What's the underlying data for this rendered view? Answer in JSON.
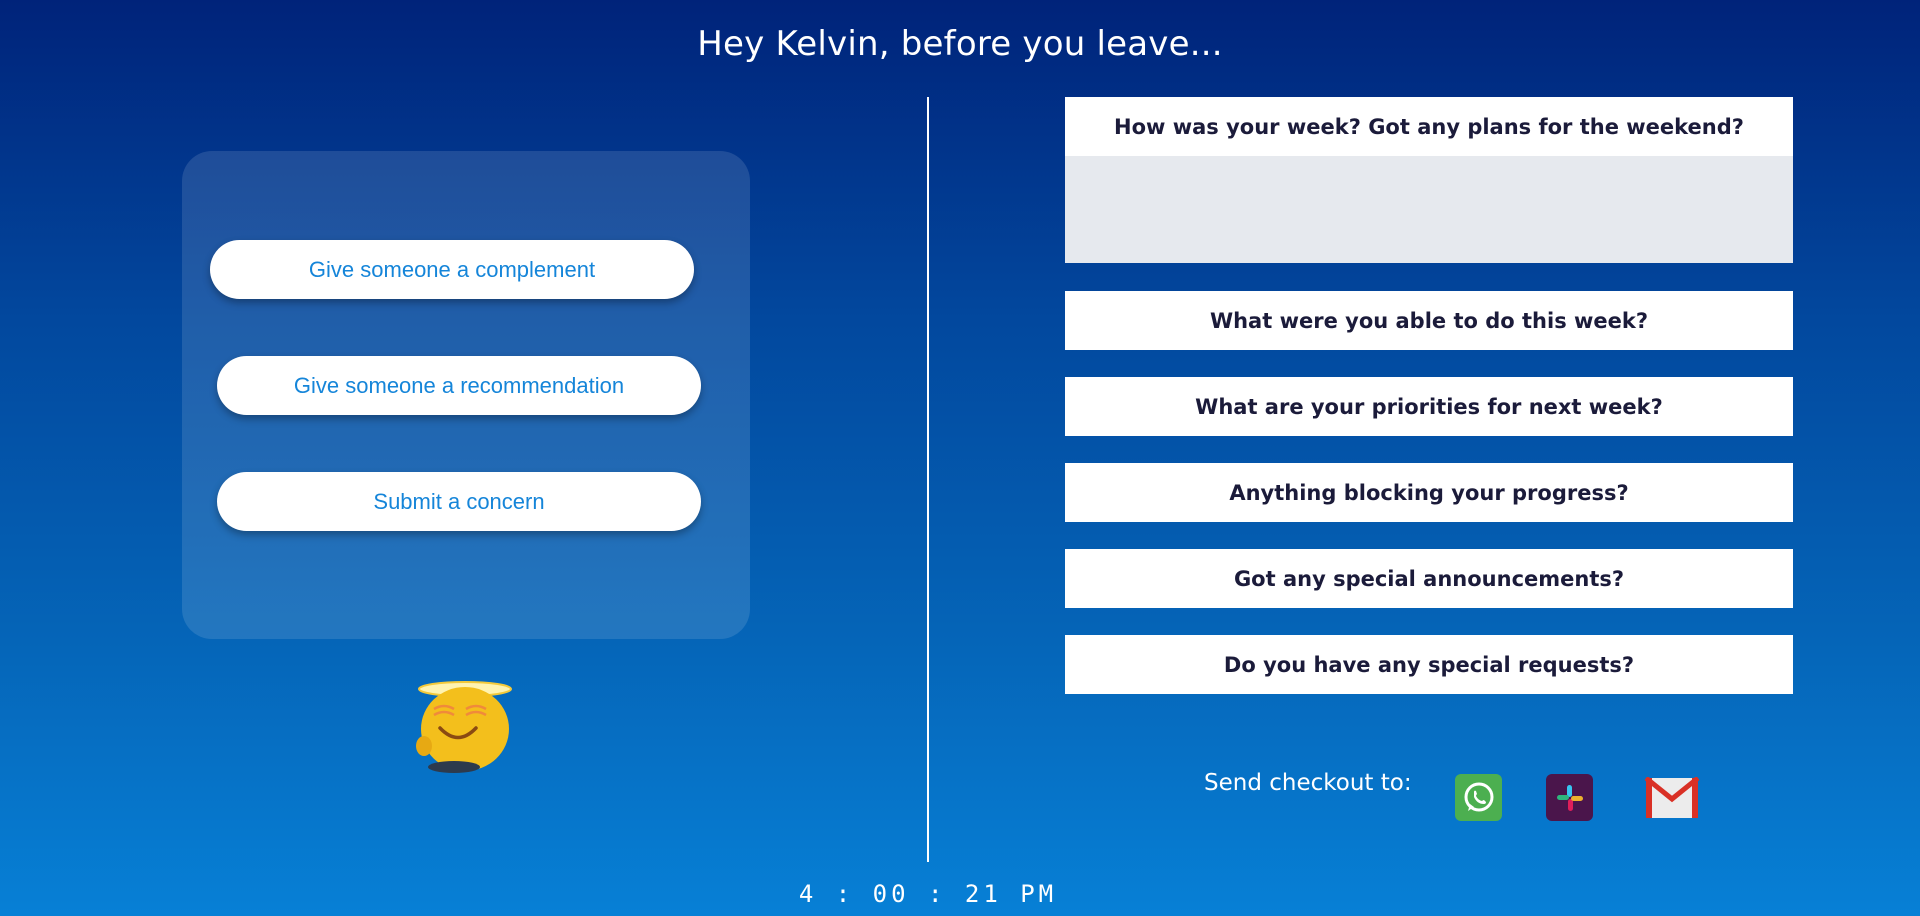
{
  "header": {
    "title": "Hey Kelvin, before you leave..."
  },
  "actions": {
    "complement_label": "Give someone a complement",
    "recommendation_label": "Give someone a recommendation",
    "concern_label": "Submit a concern"
  },
  "questions": [
    {
      "label": "How was your week? Got any plans for the weekend?",
      "value": ""
    },
    {
      "label": "What were you able to do this week?"
    },
    {
      "label": "What are your priorities for next week?"
    },
    {
      "label": "Anything blocking your progress?"
    },
    {
      "label": "Got any special announcements?"
    },
    {
      "label": "Do you have any special requests?"
    }
  ],
  "send": {
    "label": "Send checkout to:",
    "targets": [
      {
        "icon": "whatsapp-icon",
        "color": "#4caf50"
      },
      {
        "icon": "slack-icon",
        "color": "#4a154b"
      },
      {
        "icon": "gmail-icon",
        "color": "#e53935"
      }
    ]
  },
  "clock": {
    "time": "4 : 00 : 21 PM"
  },
  "colors": {
    "accent": "#1585d9",
    "question_text": "#1b1b3a",
    "textarea_bg": "#e6e9ee"
  }
}
